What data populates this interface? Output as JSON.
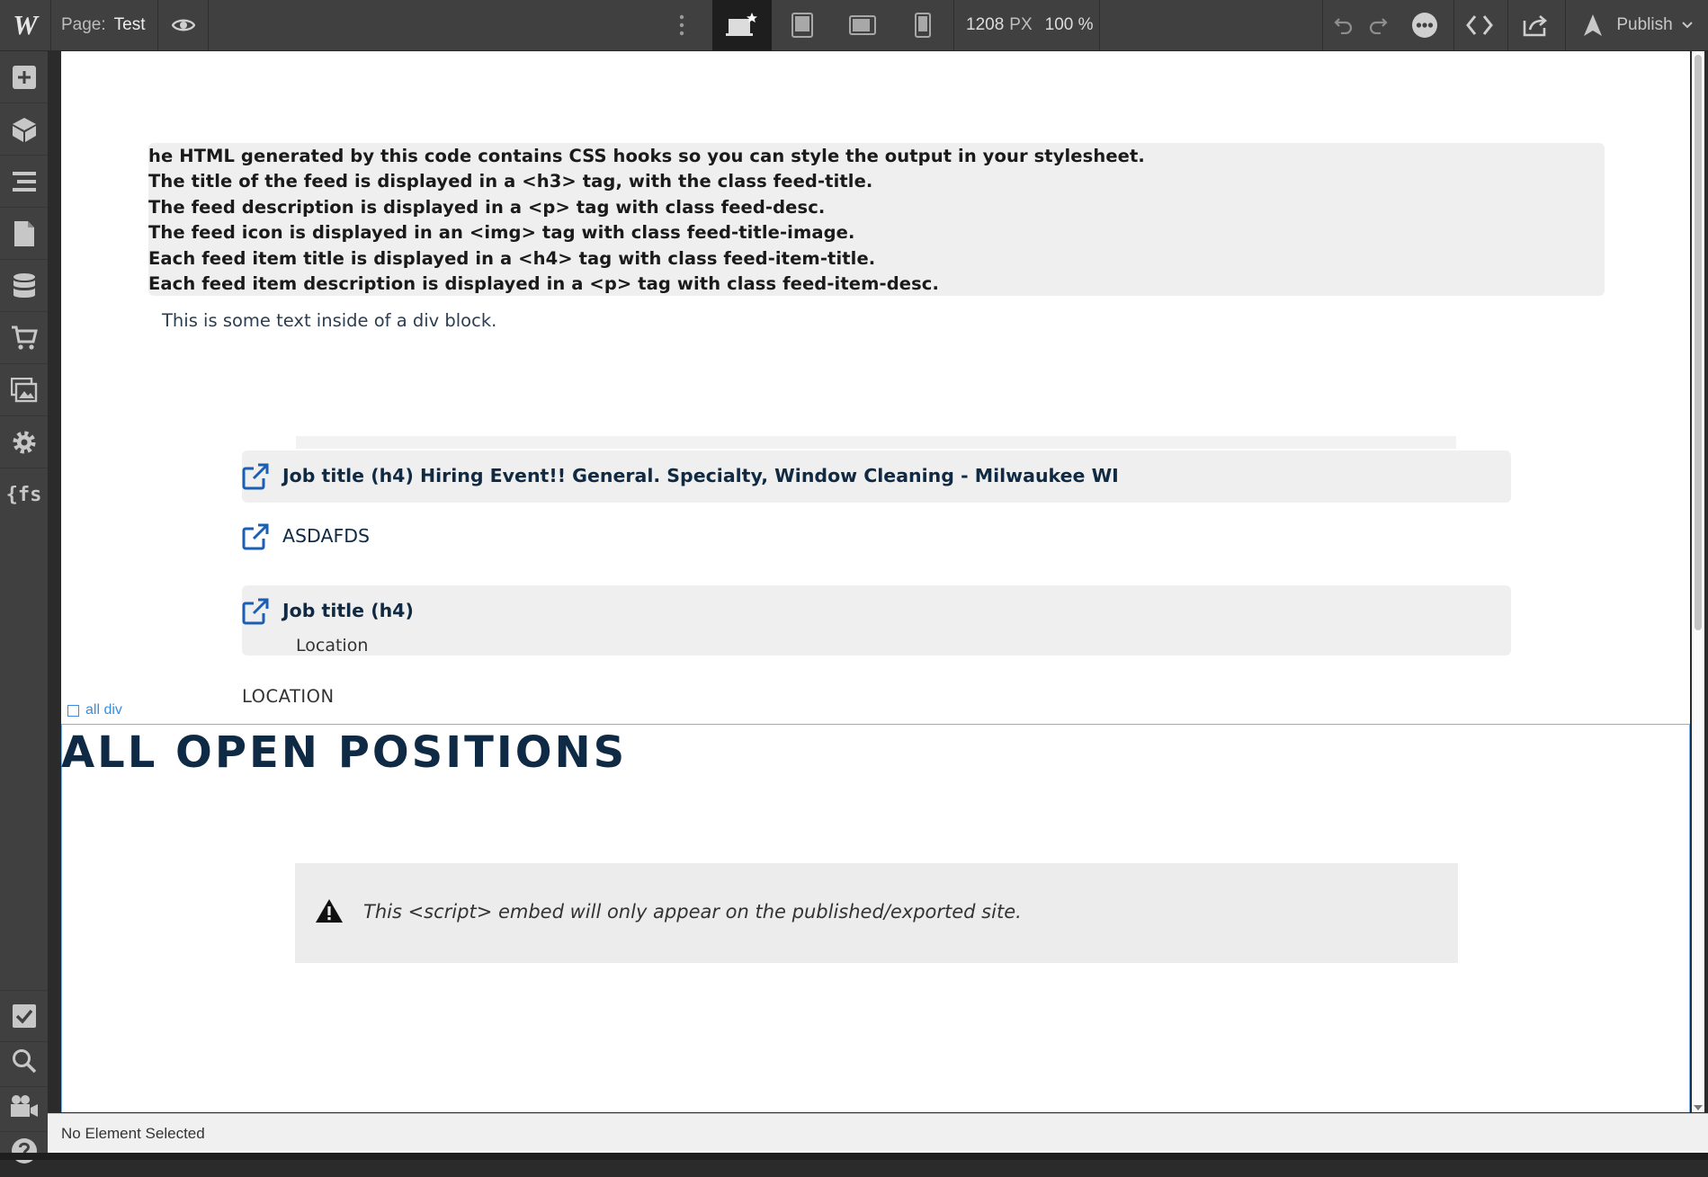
{
  "topbar": {
    "logo": "W",
    "page_prefix": "Page:",
    "page_name": "Test",
    "width_value": "1208",
    "width_unit": "PX",
    "zoom": "100 %",
    "publish_label": "Publish",
    "active_device": "desktop"
  },
  "sidebar": {
    "fs_label": "{fs"
  },
  "canvas": {
    "code_lines": [
      "he HTML generated by this code contains CSS hooks so you can style the output in your stylesheet.",
      "The title of the feed is displayed in a <h3> tag, with the class feed-title.",
      "The feed description is displayed in a <p> tag with class feed-desc.",
      "The feed icon is displayed in an <img> tag with class feed-title-image.",
      "Each feed item title is displayed in a <h4> tag with class feed-item-title.",
      "Each feed item description is displayed in a <p> tag with class feed-item-desc."
    ],
    "div_text": "This is some text inside of a div block.",
    "job1_title": "Job title (h4) Hiring Event!! General. Specialty, Window Cleaning - Milwaukee WI",
    "job2_title": "ASDAFDS",
    "job3_title": "Job title (h4)",
    "job3_location": "Location",
    "location_caps": "LOCATION",
    "all_div_label": "all div",
    "open_positions_title": "ALL OPEN POSITIONS",
    "embed_notice": "This <script> embed will only appear on the published/exported site."
  },
  "status": {
    "text": "No Element Selected"
  },
  "colors": {
    "chrome": "#404040",
    "accent_blue": "#3a8dde",
    "link_icon": "#1a5fb4",
    "heading_navy": "#0f2a44"
  }
}
